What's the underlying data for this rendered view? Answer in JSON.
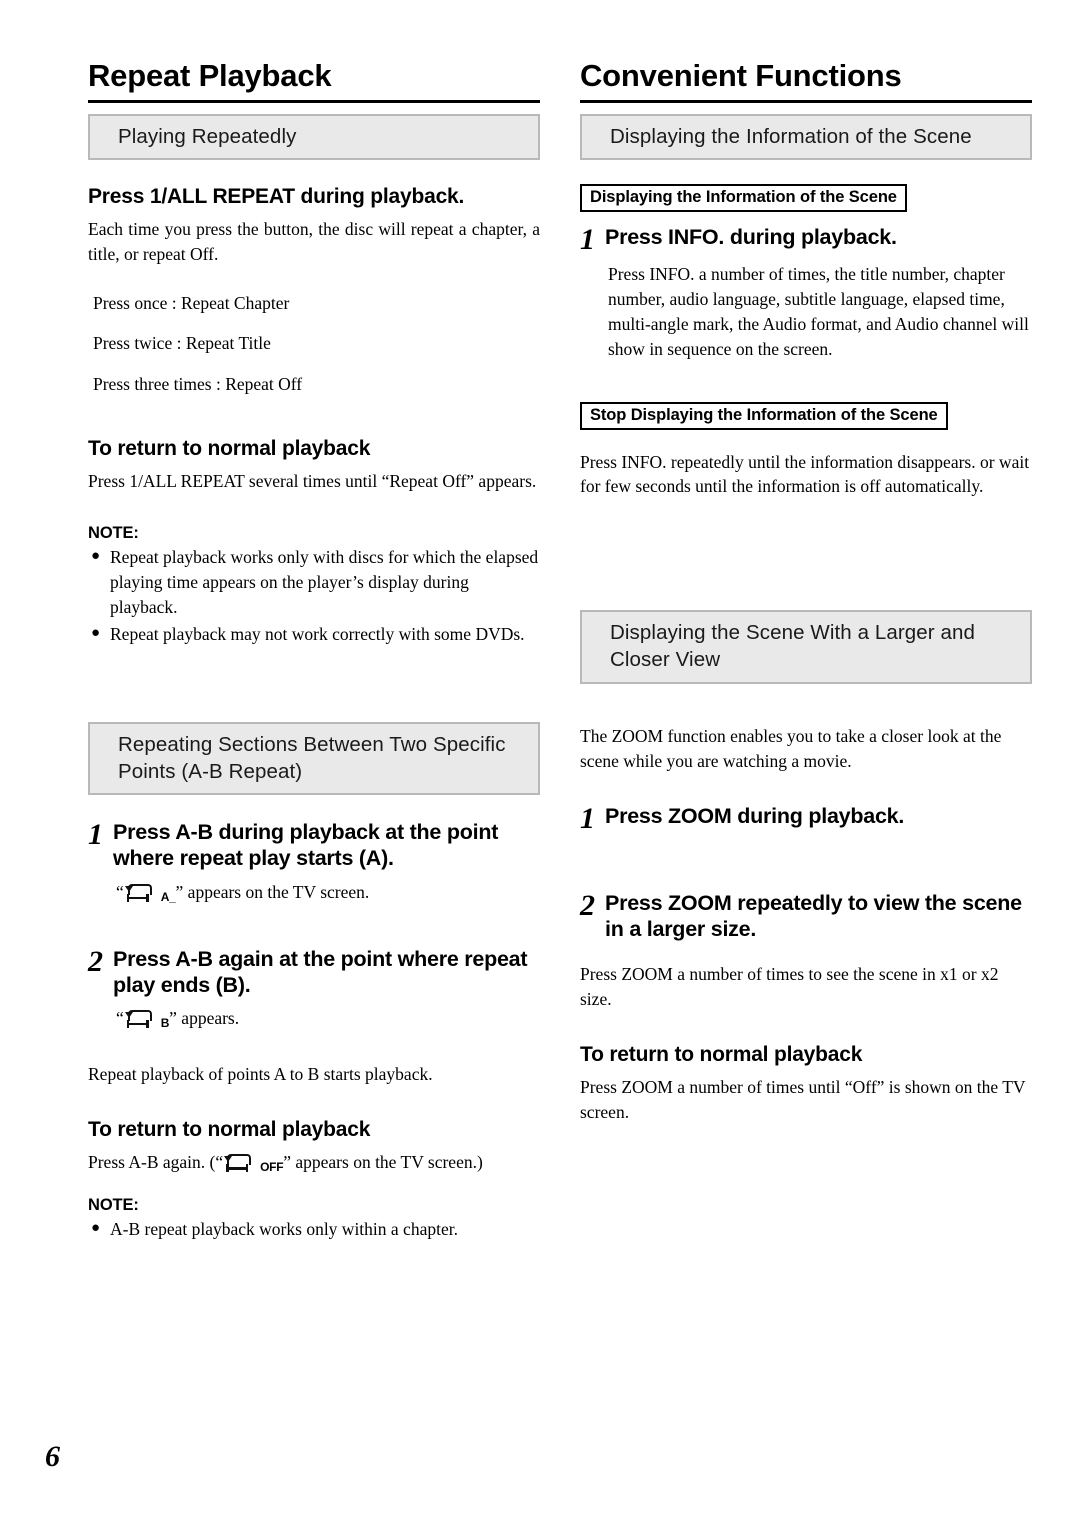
{
  "page": {
    "number": "6"
  },
  "left": {
    "chapter_title": "Repeat Playback",
    "banner1": "Playing Repeatedly",
    "heading1": "Press 1/ALL REPEAT during playback.",
    "intro1": "Each time you press the button, the disc will repeat a chapter, a title, or repeat Off.",
    "press_list": [
      "Press once  : Repeat Chapter",
      "Press twice : Repeat Title",
      "Press three times : Repeat Off"
    ],
    "return_heading1": "To return to normal playback",
    "return_text1": "Press 1/ALL REPEAT several times until “Repeat Off”  appears.",
    "note1_label": "NOTE:",
    "note1_items": [
      "Repeat playback works only with discs for which the elapsed playing time appears on the player’s display during playback.",
      "Repeat playback may not work correctly with some DVDs."
    ],
    "banner2": "Repeating Sections Between Two Specific Points (A-B Repeat)",
    "step1_num": "1",
    "step1_text": "Press A-B during playback at the point where repeat play starts (A).",
    "step1_caption_pre": "“",
    "step1_caption_sub": "A_",
    "step1_caption_post": "” appears on the TV screen.",
    "step2_num": "2",
    "step2_text": "Press A-B again at the point where repeat play ends (B).",
    "step2_caption_pre": "“",
    "step2_caption_sub": "B",
    "step2_caption_post": "” appears.",
    "after_steps_text": "Repeat playback of points A to B starts playback.",
    "return_heading2": "To return to normal playback",
    "return_text2_pre": "Press A-B again. (“",
    "return_text2_sub": "OFF",
    "return_text2_post": "” appears on the TV screen.)",
    "note2_label": "NOTE:",
    "note2_items": [
      "A-B repeat playback works only within a chapter."
    ]
  },
  "right": {
    "chapter_title": "Convenient Functions",
    "banner1": "Displaying the Information of the Scene",
    "label_box1": "Displaying the Information of  the Scene",
    "step1_num": "1",
    "step1_text": "Press INFO. during playback.",
    "step1_body": "Press INFO. a number of times, the title number, chapter number, audio language, subtitle language, elapsed time, multi-angle mark, the Audio format, and Audio channel  will show in sequence on the screen.",
    "label_box2": "Stop Displaying the Information of the Scene",
    "stop_body": "Press INFO. repeatedly until the information disappears. or wait for few seconds until the information is off automatically.",
    "banner2": "Displaying the Scene With a Larger and Closer View",
    "zoom_intro": "The ZOOM function enables you to take a closer look at the scene while you are watching a movie.",
    "zstep1_num": "1",
    "zstep1_text": "Press ZOOM during playback.",
    "zstep2_num": "2",
    "zstep2_text": "Press ZOOM repeatedly to view the scene in a larger size.",
    "zstep2_body": "Press ZOOM a number of times to see the scene in x1 or x2 size.",
    "return_heading": "To return to normal playback",
    "return_text": "Press ZOOM a number of times until “Off” is shown on the TV screen."
  }
}
